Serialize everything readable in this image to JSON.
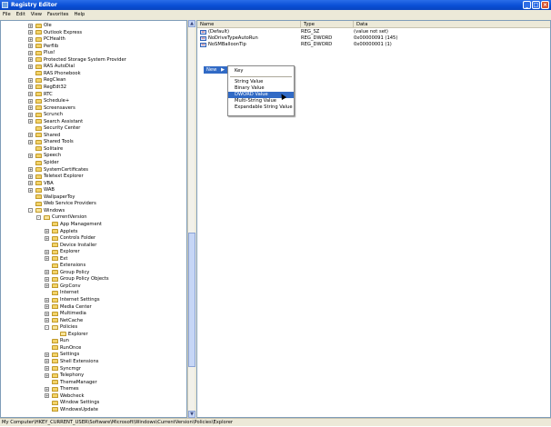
{
  "window": {
    "title": "Registry Editor"
  },
  "menu": [
    "File",
    "Edit",
    "View",
    "Favorites",
    "Help"
  ],
  "tree": [
    {
      "label": "Ole",
      "level": 0,
      "expander": "+",
      "open": false
    },
    {
      "label": "Outlook Express",
      "level": 0,
      "expander": "+",
      "open": false
    },
    {
      "label": "PCHealth",
      "level": 0,
      "expander": "+",
      "open": false
    },
    {
      "label": "Perflib",
      "level": 0,
      "expander": "+",
      "open": false
    },
    {
      "label": "Plus!",
      "level": 0,
      "expander": "+",
      "open": false
    },
    {
      "label": "Protected Storage System Provider",
      "level": 0,
      "expander": "+",
      "open": false
    },
    {
      "label": "RAS AutoDial",
      "level": 0,
      "expander": "+",
      "open": false
    },
    {
      "label": "RAS Phonebook",
      "level": 0,
      "expander": "",
      "open": false
    },
    {
      "label": "RegClean",
      "level": 0,
      "expander": "+",
      "open": false
    },
    {
      "label": "RegEdt32",
      "level": 0,
      "expander": "+",
      "open": false
    },
    {
      "label": "RTC",
      "level": 0,
      "expander": "+",
      "open": false
    },
    {
      "label": "Schedule+",
      "level": 0,
      "expander": "+",
      "open": false
    },
    {
      "label": "Screensavers",
      "level": 0,
      "expander": "+",
      "open": false
    },
    {
      "label": "Scrunch",
      "level": 0,
      "expander": "+",
      "open": false
    },
    {
      "label": "Search Assistant",
      "level": 0,
      "expander": "+",
      "open": false
    },
    {
      "label": "Security Center",
      "level": 0,
      "expander": "",
      "open": false
    },
    {
      "label": "Shared",
      "level": 0,
      "expander": "+",
      "open": false
    },
    {
      "label": "Shared Tools",
      "level": 0,
      "expander": "+",
      "open": false
    },
    {
      "label": "Solitaire",
      "level": 0,
      "expander": "",
      "open": false
    },
    {
      "label": "Speech",
      "level": 0,
      "expander": "+",
      "open": false
    },
    {
      "label": "Spider",
      "level": 0,
      "expander": "",
      "open": false
    },
    {
      "label": "SystemCertificates",
      "level": 0,
      "expander": "+",
      "open": false
    },
    {
      "label": "Teletext Explorer",
      "level": 0,
      "expander": "+",
      "open": false
    },
    {
      "label": "VBA",
      "level": 0,
      "expander": "+",
      "open": false
    },
    {
      "label": "WAB",
      "level": 0,
      "expander": "+",
      "open": false
    },
    {
      "label": "WallpaperToy",
      "level": 0,
      "expander": "",
      "open": false
    },
    {
      "label": "Web Service Providers",
      "level": 0,
      "expander": "",
      "open": false
    },
    {
      "label": "Windows",
      "level": 0,
      "expander": "-",
      "open": true
    },
    {
      "label": "CurrentVersion",
      "level": 1,
      "expander": "-",
      "open": true
    },
    {
      "label": "App Management",
      "level": 2,
      "expander": "",
      "open": false
    },
    {
      "label": "Applets",
      "level": 2,
      "expander": "+",
      "open": false
    },
    {
      "label": "Controls Folder",
      "level": 2,
      "expander": "+",
      "open": false
    },
    {
      "label": "Device Installer",
      "level": 2,
      "expander": "",
      "open": false
    },
    {
      "label": "Explorer",
      "level": 2,
      "expander": "+",
      "open": false
    },
    {
      "label": "Ext",
      "level": 2,
      "expander": "+",
      "open": false
    },
    {
      "label": "Extensions",
      "level": 2,
      "expander": "",
      "open": false
    },
    {
      "label": "Group Policy",
      "level": 2,
      "expander": "+",
      "open": false
    },
    {
      "label": "Group Policy Objects",
      "level": 2,
      "expander": "+",
      "open": false
    },
    {
      "label": "GrpConv",
      "level": 2,
      "expander": "+",
      "open": false
    },
    {
      "label": "Internet",
      "level": 2,
      "expander": "",
      "open": false
    },
    {
      "label": "Internet Settings",
      "level": 2,
      "expander": "+",
      "open": false
    },
    {
      "label": "Media Center",
      "level": 2,
      "expander": "+",
      "open": false
    },
    {
      "label": "Multimedia",
      "level": 2,
      "expander": "+",
      "open": false
    },
    {
      "label": "NetCache",
      "level": 2,
      "expander": "+",
      "open": false
    },
    {
      "label": "Policies",
      "level": 2,
      "expander": "-",
      "open": true
    },
    {
      "label": "Explorer",
      "level": 3,
      "expander": "",
      "open": true
    },
    {
      "label": "Run",
      "level": 2,
      "expander": "",
      "open": false
    },
    {
      "label": "RunOnce",
      "level": 2,
      "expander": "",
      "open": false
    },
    {
      "label": "Settings",
      "level": 2,
      "expander": "+",
      "open": false
    },
    {
      "label": "Shell Extensions",
      "level": 2,
      "expander": "+",
      "open": false
    },
    {
      "label": "Syncmgr",
      "level": 2,
      "expander": "+",
      "open": false
    },
    {
      "label": "Telephony",
      "level": 2,
      "expander": "+",
      "open": false
    },
    {
      "label": "ThemeManager",
      "level": 2,
      "expander": "",
      "open": false
    },
    {
      "label": "Themes",
      "level": 2,
      "expander": "+",
      "open": false
    },
    {
      "label": "Webcheck",
      "level": 2,
      "expander": "+",
      "open": false
    },
    {
      "label": "Window Settings",
      "level": 2,
      "expander": "",
      "open": false
    },
    {
      "label": "WindowsUpdate",
      "level": 2,
      "expander": "",
      "open": false
    }
  ],
  "list": {
    "columns": [
      "Name",
      "Type",
      "Data"
    ],
    "rows": [
      {
        "name": "(Default)",
        "type": "REG_SZ",
        "data": "(value not set)",
        "icon": "ab"
      },
      {
        "name": "NoDriveTypeAutoRun",
        "type": "REG_DWORD",
        "data": "0x00000091 (145)",
        "icon": "01"
      },
      {
        "name": "NoSMBalloonTip",
        "type": "REG_DWORD",
        "data": "0x00000001 (1)",
        "icon": "01"
      }
    ]
  },
  "context_menu": {
    "main_label": "New",
    "items": [
      "Key",
      "String Value",
      "Binary Value",
      "DWORD Value",
      "Multi-String Value",
      "Expandable String Value"
    ],
    "highlighted": "DWORD Value"
  },
  "status": "My Computer\\HKEY_CURRENT_USER\\Software\\Microsoft\\Windows\\CurrentVersion\\Policies\\Explorer"
}
